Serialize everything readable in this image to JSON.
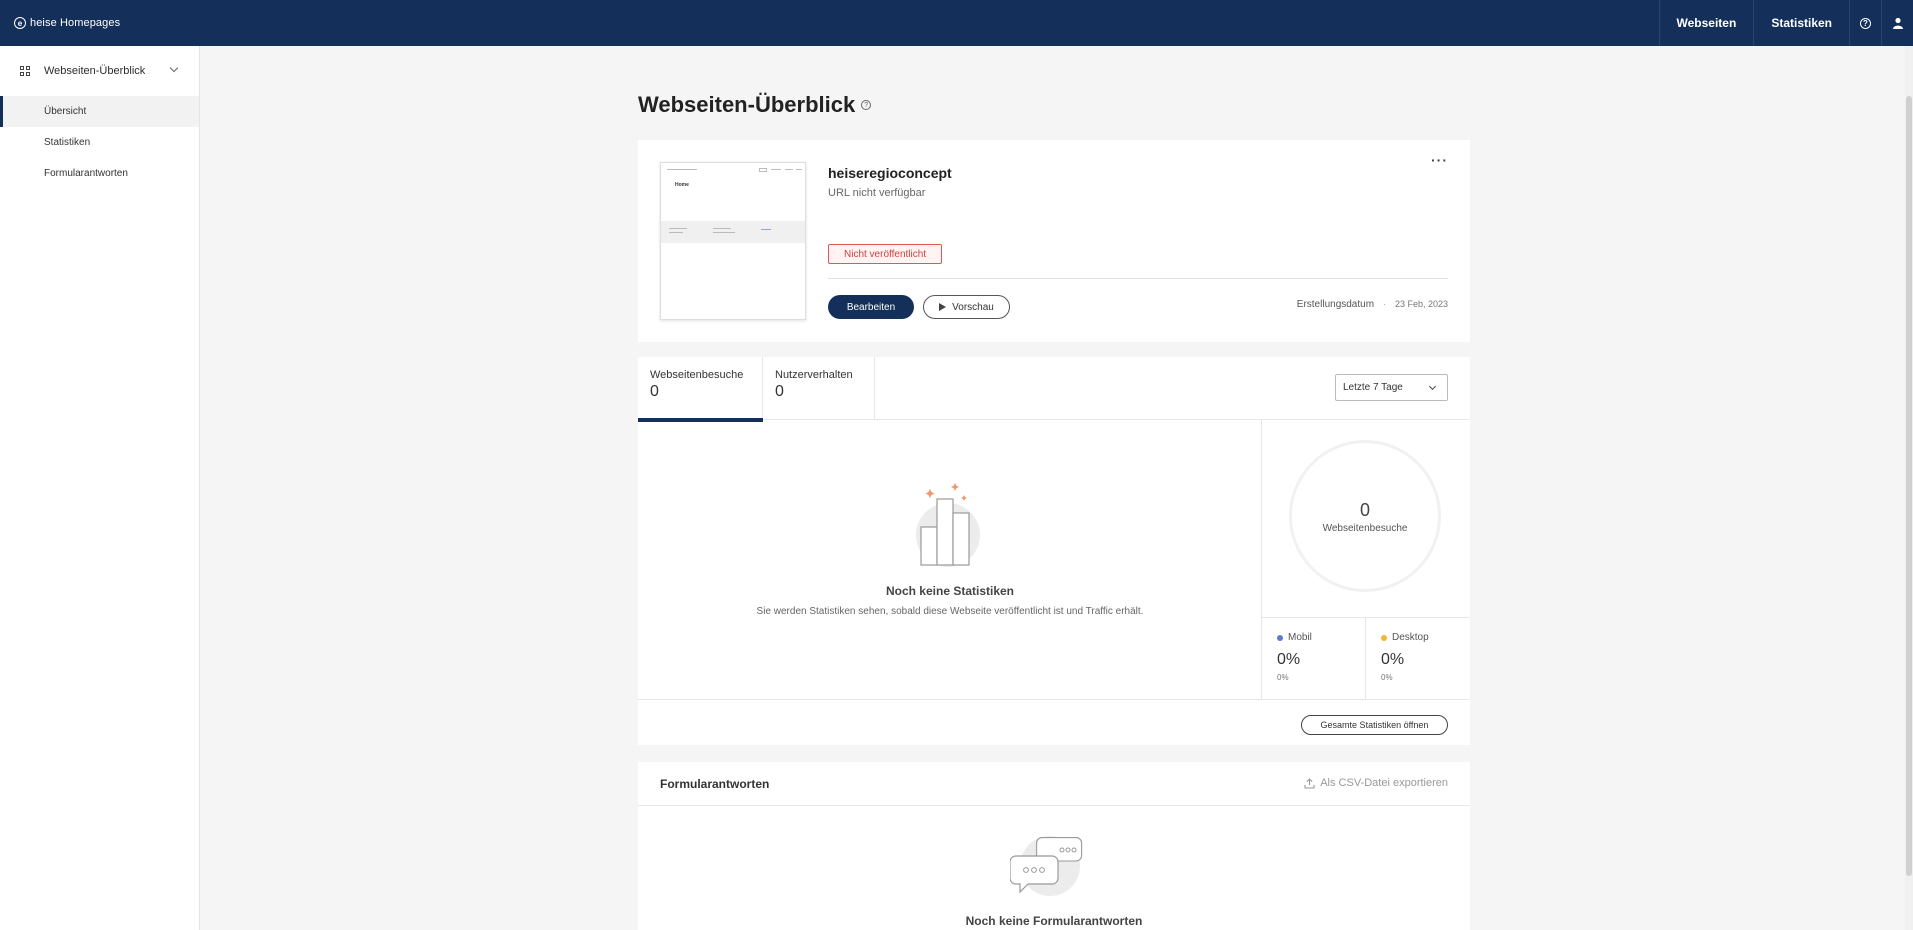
{
  "topbar": {
    "logo": "heise Homepages",
    "nav": [
      "Webseiten",
      "Statistiken"
    ]
  },
  "sidebar": {
    "section": "Webseiten-Überblick",
    "items": [
      {
        "label": "Übersicht",
        "active": true
      },
      {
        "label": "Statistiken",
        "active": false
      },
      {
        "label": "Formularantworten",
        "active": false
      }
    ]
  },
  "page": {
    "title": "Webseiten-Überblick"
  },
  "site": {
    "thumbnail_title": "Home",
    "name": "heiseregioconcept",
    "url": "URL nicht verfügbar",
    "status": "Nicht veröffentlicht",
    "edit_label": "Bearbeiten",
    "preview_label": "Vorschau",
    "created_label": "Erstellungsdatum",
    "created_date": "23 Feb, 2023"
  },
  "stats": {
    "tabs": [
      {
        "label": "Webseitenbesuche",
        "value": "0"
      },
      {
        "label": "Nutzerverhalten",
        "value": "0"
      }
    ],
    "range": "Letzte 7 Tage",
    "empty_title": "Noch keine Statistiken",
    "empty_text": "Sie werden Statistiken sehen, sobald diese Webseite veröffentlicht ist und Traffic erhält.",
    "total_value": "0",
    "total_label": "Webseitenbesuche",
    "mobile": {
      "label": "Mobil",
      "pct": "0%",
      "sub": "0%",
      "color": "#5b7bd5"
    },
    "desktop": {
      "label": "Desktop",
      "pct": "0%",
      "sub": "0%",
      "color": "#f2b632"
    },
    "open_all": "Gesamte Statistiken öffnen"
  },
  "forms": {
    "title": "Formularantworten",
    "export": "Als CSV-Datei exportieren",
    "empty_title": "Noch keine Formularantworten"
  },
  "colors": {
    "brand": "#14305a",
    "danger": "#d43f3f"
  }
}
